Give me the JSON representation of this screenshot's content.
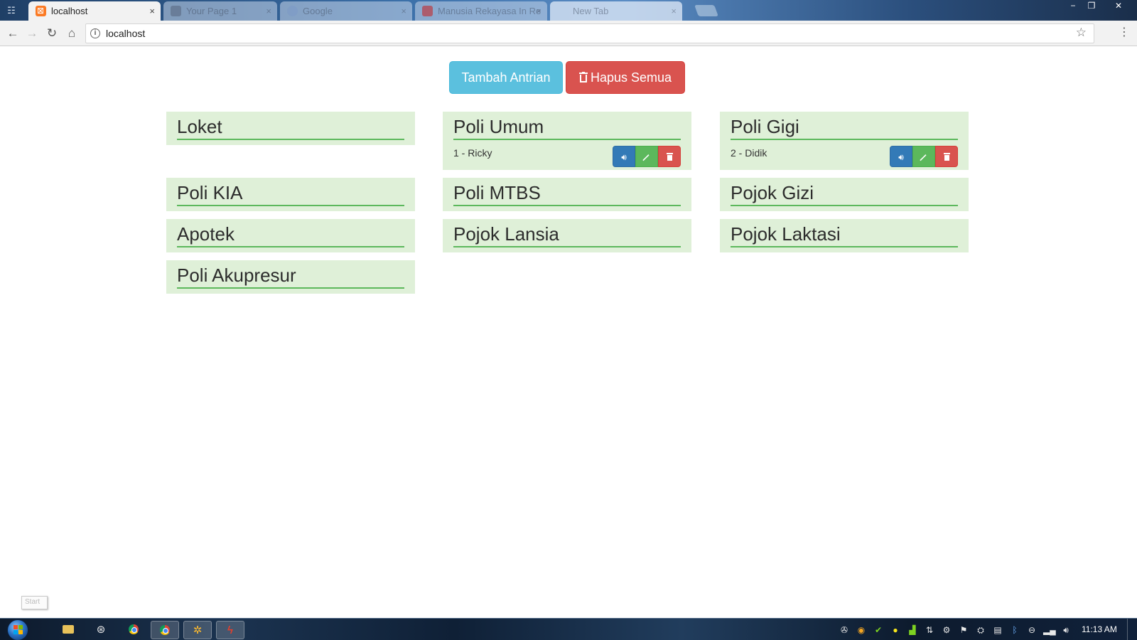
{
  "browser": {
    "tabs": [
      {
        "title": "localhost",
        "favicon": "xampp-icon",
        "active": true
      },
      {
        "title": "Your Page 1",
        "favicon": "page-icon",
        "active": false
      },
      {
        "title": "Google",
        "favicon": "google-icon",
        "active": false
      },
      {
        "title": "Manusia Rekayasa In Re",
        "favicon": "youtube-icon",
        "active": false
      },
      {
        "title": "New Tab",
        "favicon": "blank-icon",
        "active": false
      }
    ],
    "tab_close_glyph": "×",
    "address": "localhost",
    "window_controls": {
      "minimize": "−",
      "restore": "❐",
      "close": "✕"
    }
  },
  "actions": {
    "add_queue": "Tambah Antrian",
    "delete_all": "Hapus Semua"
  },
  "services": [
    {
      "name": "Loket",
      "queue": null
    },
    {
      "name": "Poli Umum",
      "queue": "1 - Ricky"
    },
    {
      "name": "Poli Gigi",
      "queue": "2 - Didik"
    },
    {
      "name": "Poli KIA",
      "queue": null
    },
    {
      "name": "Poli MTBS",
      "queue": null
    },
    {
      "name": "Pojok Gizi",
      "queue": null
    },
    {
      "name": "Apotek",
      "queue": null
    },
    {
      "name": "Pojok Lansia",
      "queue": null
    },
    {
      "name": "Pojok Laktasi",
      "queue": null
    },
    {
      "name": "Poli Akupresur",
      "queue": null
    }
  ],
  "taskbar": {
    "start_tooltip": "Start",
    "clock": "11:13 AM"
  },
  "colors": {
    "panel_bg": "#dff0d8",
    "panel_rule": "#5cb85c",
    "info": "#5bc0de",
    "danger": "#d9534f",
    "primary": "#337ab7",
    "success": "#5cb85c"
  }
}
